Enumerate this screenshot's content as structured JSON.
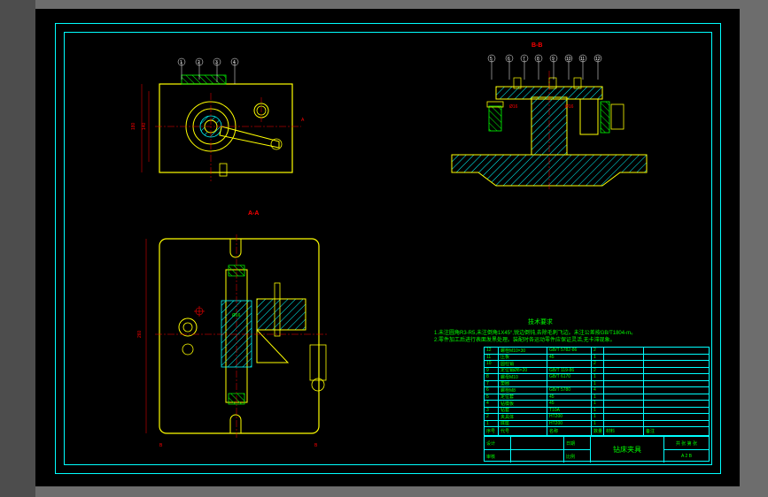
{
  "drawing": {
    "section_bb_label": "B-B",
    "section_aa_label": "A-A",
    "callouts_top_left": [
      "1",
      "2",
      "3",
      "4"
    ],
    "callouts_top_right": [
      "5",
      "6",
      "7",
      "8",
      "9",
      "10",
      "11",
      "12"
    ],
    "dims": {
      "top_left_height": "180",
      "top_left_height2": "140",
      "bottom_width": "260",
      "diameter1": "Ø16",
      "diameter2": "Ø16",
      "section_arrow_a": "A",
      "section_arrow_b": "B"
    }
  },
  "notes": {
    "title": "技术要求",
    "line1": "1.未注圆角R3-R5,未注倒角1X45°,锐边倒钝,去除毛刺飞边。未注公差按GB/T1804-m。",
    "line2": "2.零件加工后进行表面发黑处理。装配时各运动零件应保证灵活,无卡滞现象。"
  },
  "title_block": {
    "rows": [
      {
        "c1": "12",
        "c2": "螺栓M10×30",
        "c3": "",
        "c4": "GB/T 5782-86",
        "c5": "2",
        "c6": "",
        "c7": "",
        "c8": ""
      },
      {
        "c1": "11",
        "c2": "压板",
        "c3": "",
        "c4": "45",
        "c5": "1",
        "c6": "",
        "c7": "",
        "c8": ""
      },
      {
        "c1": "10",
        "c2": "圆柱销",
        "c3": "",
        "c4": "",
        "c5": "2",
        "c6": "",
        "c7": "",
        "c8": ""
      },
      {
        "c1": "9",
        "c2": "定位销Ø8×20",
        "c3": "",
        "c4": "GB/T 119-86",
        "c5": "2",
        "c6": "",
        "c7": "",
        "c8": ""
      },
      {
        "c1": "8",
        "c2": "螺母M10",
        "c3": "",
        "c4": "GB/T 6170",
        "c5": "1",
        "c6": "",
        "c7": "",
        "c8": ""
      },
      {
        "c1": "7",
        "c2": "垫圈",
        "c3": "",
        "c4": "",
        "c5": "1",
        "c6": "",
        "c7": "",
        "c8": ""
      },
      {
        "c1": "6",
        "c2": "螺栓M8",
        "c3": "",
        "c4": "GB/T 5780",
        "c5": "4",
        "c6": "",
        "c7": "",
        "c8": ""
      },
      {
        "c1": "5",
        "c2": "定位套",
        "c3": "",
        "c4": "45",
        "c5": "1",
        "c6": "",
        "c7": "",
        "c8": ""
      },
      {
        "c1": "4",
        "c2": "钻模板",
        "c3": "",
        "c4": "45",
        "c5": "1",
        "c6": "",
        "c7": "",
        "c8": ""
      },
      {
        "c1": "3",
        "c2": "钻套",
        "c3": "",
        "c4": "T10A",
        "c5": "1",
        "c6": "",
        "c7": "",
        "c8": ""
      },
      {
        "c1": "2",
        "c2": "夹具体",
        "c3": "",
        "c4": "HT200",
        "c5": "1",
        "c6": "",
        "c7": "",
        "c8": ""
      },
      {
        "c1": "1",
        "c2": "底座",
        "c3": "",
        "c4": "HT200",
        "c5": "1",
        "c6": "",
        "c7": "",
        "c8": ""
      }
    ],
    "header": {
      "c1": "序号",
      "c2": "代号",
      "c3": "名称",
      "c4": "",
      "c5": "数量",
      "c6": "材料",
      "c7": "",
      "c8": "备注"
    },
    "footer": {
      "design": "设计",
      "check": "审核",
      "approve": "批准",
      "date": "日期",
      "scale": "比例",
      "sheet": "共 张 第 张",
      "title": "钻床夹具",
      "dwg_no": "",
      "size": "A  2  B"
    }
  },
  "colors": {
    "bg": "#000000",
    "frame": "#00ffff",
    "hatch": "#00ffff",
    "outline": "#ffff00",
    "center": "#ff0000",
    "text": "#00ff00"
  }
}
